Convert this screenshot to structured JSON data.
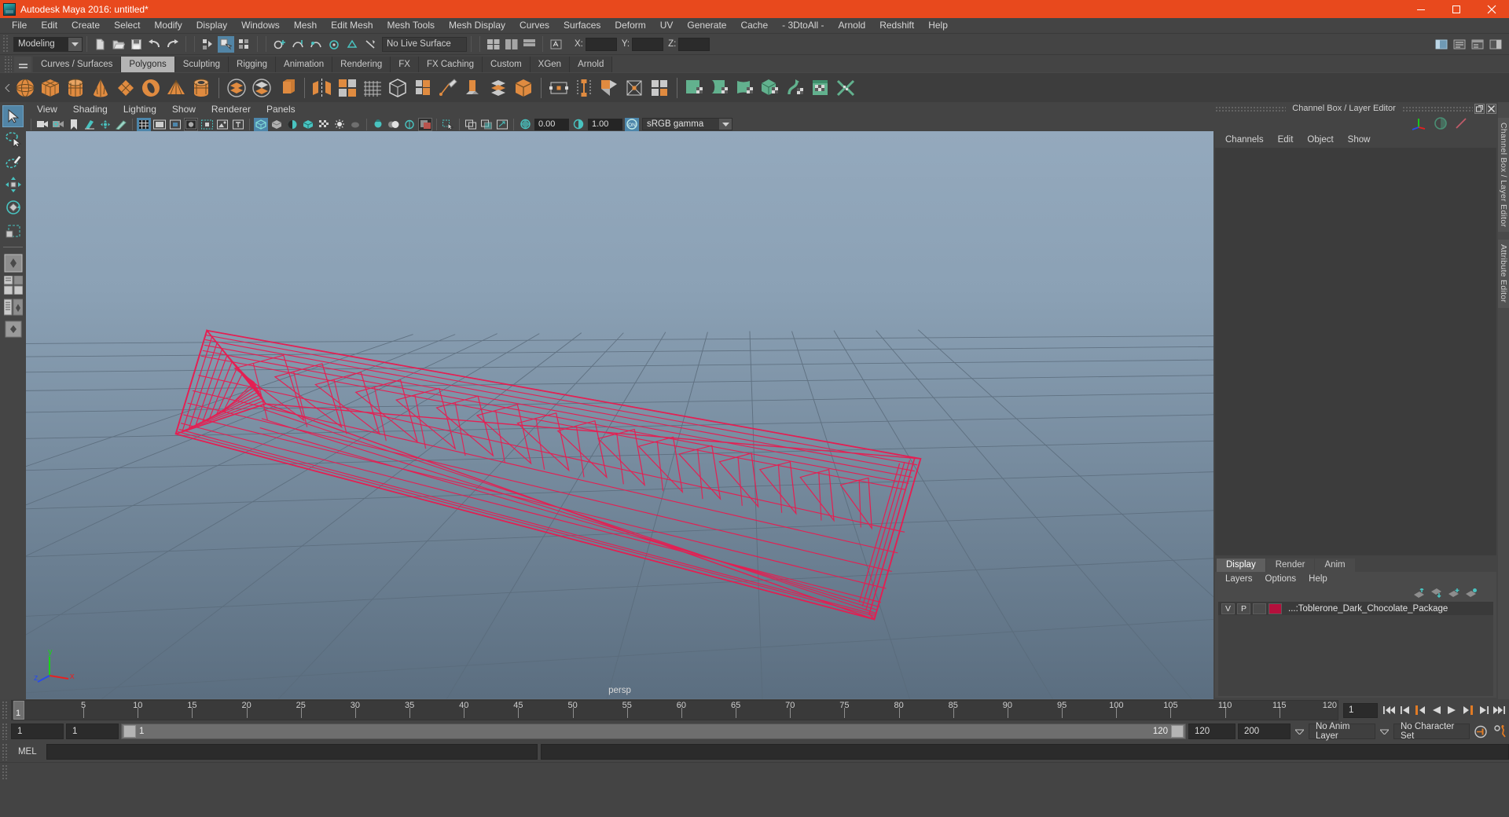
{
  "window": {
    "title": "Autodesk Maya 2016: untitled*",
    "app_icon": "maya-logo-icon",
    "buttons": {
      "minimize": "minimize-icon",
      "maximize": "maximize-icon",
      "close": "close-icon"
    },
    "accent_color": "#e8491d"
  },
  "menubar": {
    "items": [
      "File",
      "Edit",
      "Create",
      "Select",
      "Modify",
      "Display",
      "Windows",
      "Mesh",
      "Edit Mesh",
      "Mesh Tools",
      "Mesh Display",
      "Curves",
      "Surfaces",
      "Deform",
      "UV",
      "Generate",
      "Cache",
      "- 3DtoAll -",
      "Arnold",
      "Redshift",
      "Help"
    ]
  },
  "statusbar": {
    "menu_set": "Modeling",
    "live_surface": "No Live Surface",
    "coords": [
      {
        "label": "X:",
        "value": ""
      },
      {
        "label": "Y:",
        "value": ""
      },
      {
        "label": "Z:",
        "value": ""
      }
    ],
    "icons": [
      "new-scene-icon",
      "open-scene-icon",
      "save-scene-icon",
      "undo-icon",
      "redo-icon",
      "select-by-hierarchy-icon",
      "select-by-object-icon",
      "select-by-component-icon",
      "snap-to-grid-icon",
      "snap-to-curve-icon",
      "snap-to-point-icon",
      "snap-to-projected-center-icon",
      "snap-to-view-plane-icon",
      "make-live-icon"
    ],
    "right_icons": [
      "show-hide-editor-icon",
      "attribute-editor-icon",
      "tool-settings-icon",
      "channel-box-icon"
    ]
  },
  "shelf": {
    "tabs": [
      "Curves / Surfaces",
      "Polygons",
      "Sculpting",
      "Rigging",
      "Animation",
      "Rendering",
      "FX",
      "FX Caching",
      "Custom",
      "XGen",
      "Arnold"
    ],
    "active_tab": "Polygons",
    "icons": [
      "poly-sphere-icon",
      "poly-cube-icon",
      "poly-cylinder-icon",
      "poly-cone-icon",
      "poly-plane-icon",
      "poly-torus-icon",
      "poly-pyramid-icon",
      "poly-pipe-icon",
      "combine-icon",
      "separate-icon",
      "extrude-icon",
      "mirror-geometry-icon",
      "mirror-cut-icon",
      "smooth-icon",
      "poly-sculpt-icon",
      "bevel-icon",
      "multi-cut-icon",
      "extrude-face-icon",
      "bridge-icon",
      "booleans-icon",
      "target-weld-icon",
      "connect-icon",
      "merge-icon",
      "detach-icon",
      "quadrangulate-icon",
      "uv-planar-icon",
      "uv-cylindrical-icon",
      "uv-spherical-icon",
      "uv-automatic-icon",
      "uv-contour-stretch-icon",
      "uv-editor-icon",
      "uv-unfold-icon"
    ]
  },
  "toolbox": {
    "tools": [
      "select-tool",
      "lasso-select-tool",
      "paint-select-tool",
      "move-tool",
      "rotate-tool",
      "scale-tool"
    ],
    "active_tool": "select-tool",
    "layout_buttons": [
      "single-perspective-view-icon",
      "four-view-layout-icon",
      "outliner-persp-layout-icon",
      "persp-graph-layout-icon",
      "hypershade-persp-layout-icon"
    ]
  },
  "viewport": {
    "menus": [
      "View",
      "Shading",
      "Lighting",
      "Show",
      "Renderer",
      "Panels"
    ],
    "toolbar": {
      "icons": [
        "select-camera-icon",
        "camera-attributes-icon",
        "bookmark-icon",
        "image-plane-icon",
        "two-d-pan-zoom-icon",
        "grease-pencil-icon",
        "grid-toggle-icon",
        "film-gate-icon",
        "resolution-gate-icon",
        "gate-mask-icon",
        "film-origin-icon",
        "xray-icon",
        "xray-joints-icon",
        "wireframe-on-shaded-icon",
        "smooth-shade-icon",
        "shaded-textured-icon",
        "lighting-icon",
        "shadows-icon",
        "screen-space-ao-icon",
        "motion-blur-icon",
        "multisample-icon",
        "isolate-select-icon",
        "display-layer-icon",
        "exposure-icon",
        "contrast-icon",
        "gamma-toggle-icon"
      ],
      "exposure_value": "0.00",
      "gamma_value": "1.00",
      "color_management": "sRGB gamma",
      "color_management_on": "ON"
    },
    "camera_label": "persp",
    "axis_labels": {
      "x": "x",
      "y": "y",
      "z": "z"
    },
    "background_top": "#8ea4b8",
    "background_bottom": "#5e7183",
    "wireframe_color": "#e8184c",
    "object_name": "Toblerone_Dark_Chocolate_Package"
  },
  "channel_box": {
    "panel_title": "Channel Box / Layer Editor",
    "menus": [
      "Channels",
      "Edit",
      "Object",
      "Show"
    ],
    "dock_buttons": [
      "undock-icon",
      "close-icon"
    ],
    "gizmo_icons": [
      "axis-gizmo-icon",
      "clock-gizmo-icon",
      "slash-gizmo-icon"
    ],
    "side_tabs": [
      "Channel Box / Layer Editor",
      "Attribute Editor"
    ]
  },
  "layer_editor": {
    "tabs": [
      "Display",
      "Render",
      "Anim"
    ],
    "active_tab": "Display",
    "menus": [
      "Layers",
      "Options",
      "Help"
    ],
    "buttons": [
      "move-layer-up-icon",
      "move-layer-down-icon",
      "new-layer-icon",
      "new-layer-from-selected-icon"
    ],
    "layers": [
      {
        "visibility": "V",
        "playback": "P",
        "shading": "",
        "color": "#b5103c",
        "name": "...:Toblerone_Dark_Chocolate_Package"
      }
    ]
  },
  "timeline": {
    "current_frame": "1",
    "start_tick": 1,
    "ticks": [
      5,
      10,
      15,
      20,
      25,
      30,
      35,
      40,
      45,
      50,
      55,
      60,
      65,
      70,
      75,
      80,
      85,
      90,
      95,
      100,
      105,
      110,
      115,
      120
    ],
    "end_label": "120",
    "current_field": "1",
    "playback_buttons": [
      "go-to-start-icon",
      "step-back-keyframe-icon",
      "step-back-frame-icon",
      "play-backwards-icon",
      "play-forwards-icon",
      "step-forward-frame-icon",
      "step-forward-keyframe-icon",
      "go-to-end-icon"
    ]
  },
  "range_slider": {
    "anim_start": "1",
    "range_start": "1",
    "bar_start_label": "1",
    "bar_end_label": "120",
    "range_end": "120",
    "anim_end": "200",
    "anim_layer": "No Anim Layer",
    "character_set": "No Character Set",
    "right_icons": [
      "auto-key-icon",
      "animation-preferences-icon"
    ]
  },
  "command_line": {
    "language_label": "MEL",
    "input_value": "",
    "input_placeholder": ""
  }
}
